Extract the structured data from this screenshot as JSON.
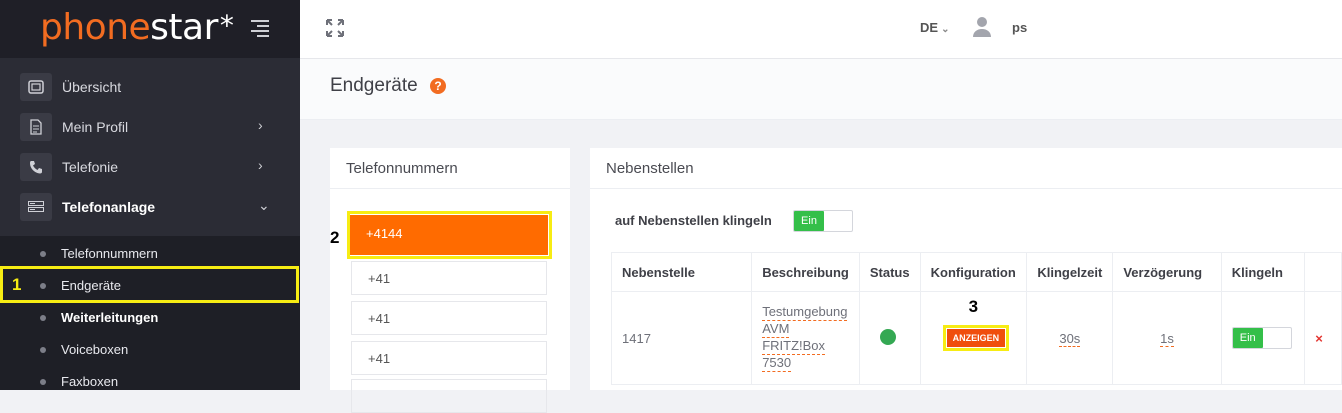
{
  "brand": {
    "logo_part1": "phone",
    "logo_part2": "star",
    "logo_star": "*"
  },
  "topbar": {
    "language": "DE",
    "language_caret": "⌄",
    "username": "ps"
  },
  "sidebar": {
    "items": [
      {
        "label": "Übersicht",
        "icon": "dashboard-icon"
      },
      {
        "label": "Mein Profil",
        "icon": "profile-document-icon",
        "chevron": "›"
      },
      {
        "label": "Telefonie",
        "icon": "phone-icon",
        "chevron": "›"
      },
      {
        "label": "Telefonanlage",
        "icon": "pbx-icon",
        "chevron": "⌄"
      }
    ],
    "submenu": [
      {
        "label": "Telefonnummern"
      },
      {
        "label": "Endgeräte"
      },
      {
        "label": "Weiterleitungen"
      },
      {
        "label": "Voiceboxen"
      },
      {
        "label": "Faxboxen"
      }
    ]
  },
  "annotations": {
    "n1": "1",
    "n2": "2",
    "n3": "3",
    "highlight_color": "#f7ec13"
  },
  "page": {
    "title": "Endgeräte",
    "help": "?"
  },
  "numbers_panel": {
    "title": "Telefonnummern",
    "numbers": [
      "+4144",
      "+41",
      "+41",
      "+41"
    ]
  },
  "extensions_panel": {
    "title": "Nebenstellen",
    "ring_label": "auf Nebenstellen klingeln",
    "ring_toggle": "Ein",
    "columns": [
      "Nebenstelle",
      "Beschreibung",
      "Status",
      "Konfiguration",
      "Klingelzeit",
      "Verzögerung",
      "Klingeln"
    ],
    "rows": [
      {
        "extension": "1417",
        "description_lines": [
          "Testumgebung",
          "AVM",
          "FRITZ!Box",
          "7530"
        ],
        "status": "online",
        "config_button": "ANZEIGEN",
        "ring_time": "30s",
        "delay": "1s",
        "ring_toggle": "Ein",
        "delete": "×"
      }
    ]
  },
  "colors": {
    "accent": "#ff6b00",
    "toggle_on": "#34bf49",
    "status_online": "#34a853"
  }
}
